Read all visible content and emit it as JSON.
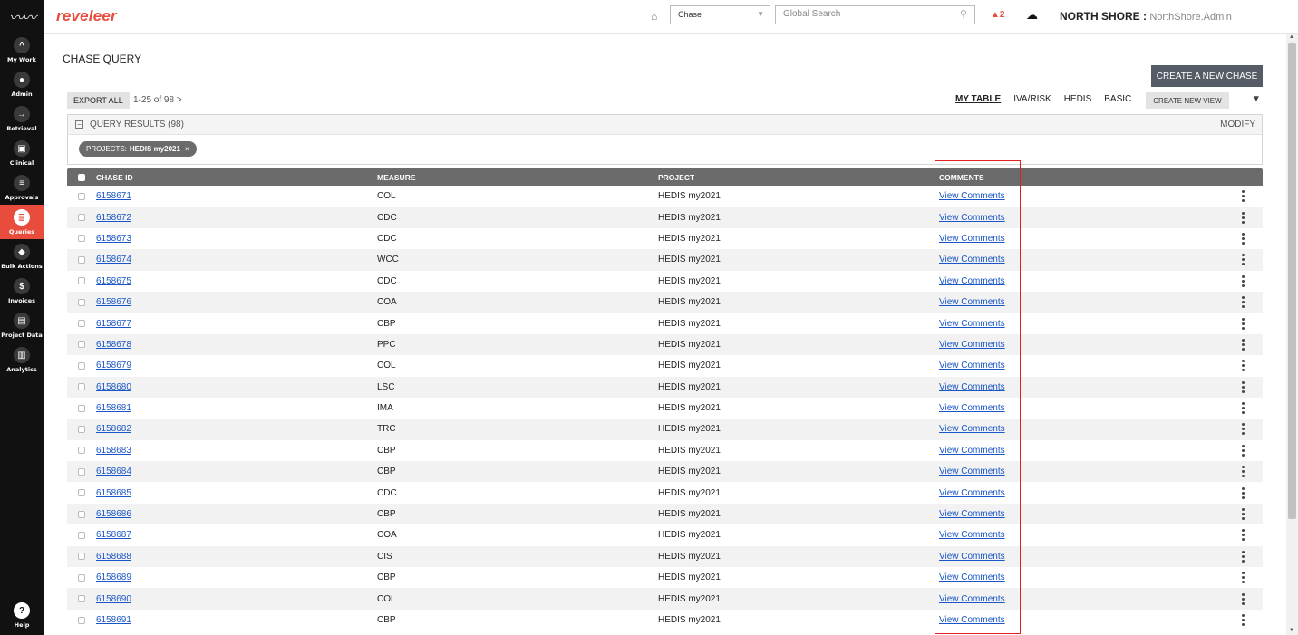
{
  "brand": "reveleer",
  "nav": [
    {
      "key": "my-work",
      "label": "My Work",
      "icon": "^"
    },
    {
      "key": "admin",
      "label": "Admin",
      "icon": "●"
    },
    {
      "key": "retrieval",
      "label": "Retrieval",
      "icon": "→"
    },
    {
      "key": "clinical",
      "label": "Clinical",
      "icon": "▣"
    },
    {
      "key": "approvals",
      "label": "Approvals",
      "icon": "≡"
    },
    {
      "key": "queries",
      "label": "Queries",
      "icon": "≣",
      "active": true
    },
    {
      "key": "bulk-actions",
      "label": "Bulk Actions",
      "icon": "◆"
    },
    {
      "key": "invoices",
      "label": "Invoices",
      "icon": "$"
    },
    {
      "key": "project-data",
      "label": "Project Data",
      "icon": "▤"
    },
    {
      "key": "analytics",
      "label": "Analytics",
      "icon": "▥"
    }
  ],
  "help_label": "Help",
  "topbar": {
    "entity_value": "Chase",
    "search_placeholder": "Global Search",
    "notifications": "2",
    "org_name": "NORTH SHORE",
    "org_user": "NorthShore.Admin"
  },
  "page": {
    "title": "CHASE QUERY",
    "create_label": "CREATE A NEW CHASE",
    "export_label": "EXPORT ALL",
    "pager": "1-25  of  98 >",
    "views": [
      "MY TABLE",
      "IVA/RISK",
      "HEDIS",
      "BASIC"
    ],
    "new_view_label": "CREATE NEW VIEW",
    "query_results": "QUERY RESULTS (98)",
    "modify_label": "MODIFY",
    "chip_key": "PROJECTS:",
    "chip_value": "HEDIS my2021",
    "chip_close": "×"
  },
  "table": {
    "headers": {
      "chase_id": "CHASE ID",
      "measure": "MEASURE",
      "project": "PROJECT",
      "comments": "COMMENTS"
    },
    "rows": [
      {
        "id": "6158671",
        "measure": "COL",
        "project": "HEDIS my2021",
        "comments": "View Comments"
      },
      {
        "id": "6158672",
        "measure": "CDC",
        "project": "HEDIS my2021",
        "comments": "View Comments"
      },
      {
        "id": "6158673",
        "measure": "CDC",
        "project": "HEDIS my2021",
        "comments": "View Comments"
      },
      {
        "id": "6158674",
        "measure": "WCC",
        "project": "HEDIS my2021",
        "comments": "View Comments"
      },
      {
        "id": "6158675",
        "measure": "CDC",
        "project": "HEDIS my2021",
        "comments": "View Comments"
      },
      {
        "id": "6158676",
        "measure": "COA",
        "project": "HEDIS my2021",
        "comments": "View Comments"
      },
      {
        "id": "6158677",
        "measure": "CBP",
        "project": "HEDIS my2021",
        "comments": "View Comments"
      },
      {
        "id": "6158678",
        "measure": "PPC",
        "project": "HEDIS my2021",
        "comments": "View Comments"
      },
      {
        "id": "6158679",
        "measure": "COL",
        "project": "HEDIS my2021",
        "comments": "View Comments"
      },
      {
        "id": "6158680",
        "measure": "LSC",
        "project": "HEDIS my2021",
        "comments": "View Comments"
      },
      {
        "id": "6158681",
        "measure": "IMA",
        "project": "HEDIS my2021",
        "comments": "View Comments"
      },
      {
        "id": "6158682",
        "measure": "TRC",
        "project": "HEDIS my2021",
        "comments": "View Comments"
      },
      {
        "id": "6158683",
        "measure": "CBP",
        "project": "HEDIS my2021",
        "comments": "View Comments"
      },
      {
        "id": "6158684",
        "measure": "CBP",
        "project": "HEDIS my2021",
        "comments": "View Comments"
      },
      {
        "id": "6158685",
        "measure": "CDC",
        "project": "HEDIS my2021",
        "comments": "View Comments"
      },
      {
        "id": "6158686",
        "measure": "CBP",
        "project": "HEDIS my2021",
        "comments": "View Comments"
      },
      {
        "id": "6158687",
        "measure": "COA",
        "project": "HEDIS my2021",
        "comments": "View Comments"
      },
      {
        "id": "6158688",
        "measure": "CIS",
        "project": "HEDIS my2021",
        "comments": "View Comments"
      },
      {
        "id": "6158689",
        "measure": "CBP",
        "project": "HEDIS my2021",
        "comments": "View Comments"
      },
      {
        "id": "6158690",
        "measure": "COL",
        "project": "HEDIS my2021",
        "comments": "View Comments"
      },
      {
        "id": "6158691",
        "measure": "CBP",
        "project": "HEDIS my2021",
        "comments": "View Comments"
      }
    ]
  },
  "colors": {
    "brand": "#e84c3d",
    "link": "#1a56c7",
    "header": "#6b6b6b",
    "highlight": "#e02020"
  }
}
